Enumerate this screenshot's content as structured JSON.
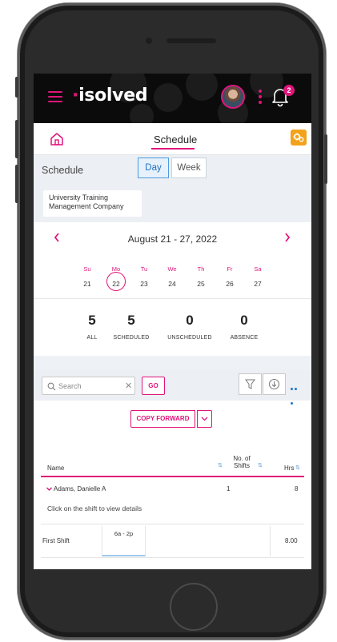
{
  "header": {
    "logo": "isolved",
    "notification_count": "2"
  },
  "page": {
    "title": "Schedule"
  },
  "toolbar": {
    "label": "Schedule",
    "view_options": [
      "Day",
      "Week"
    ],
    "selected_view": "Day",
    "company": "University Training Management Company"
  },
  "calendar": {
    "range": "August 21 - 27, 2022",
    "weekdays": [
      "Su",
      "Mo",
      "Tu",
      "We",
      "Th",
      "Fr",
      "Sa"
    ],
    "dates": [
      "21",
      "22",
      "23",
      "24",
      "25",
      "26",
      "27"
    ],
    "selected_date": "22"
  },
  "counts": [
    {
      "value": "5",
      "label": "ALL"
    },
    {
      "value": "5",
      "label": "SCHEDULED"
    },
    {
      "value": "0",
      "label": "UNSCHEDULED"
    },
    {
      "value": "0",
      "label": "ABSENCE"
    }
  ],
  "filters": {
    "search_placeholder": "Search",
    "go_label": "GO"
  },
  "actions": {
    "copy_forward_label": "COPY FORWARD"
  },
  "table": {
    "columns": {
      "name": "Name",
      "shifts": "No. of Shifts",
      "hours": "Hrs"
    },
    "employee": {
      "name": "Adams, Danielle A",
      "shifts": "1",
      "hours": "8"
    },
    "hint": "Click on the shift to view details",
    "shift_row": {
      "name": "First Shift",
      "time": "6a - 2p",
      "hours": "8.00"
    }
  },
  "colors": {
    "accent": "#e0157a",
    "header_bg": "#0b0b0b",
    "button_orange": "#f2a31b",
    "link_blue": "#1e75c9"
  }
}
